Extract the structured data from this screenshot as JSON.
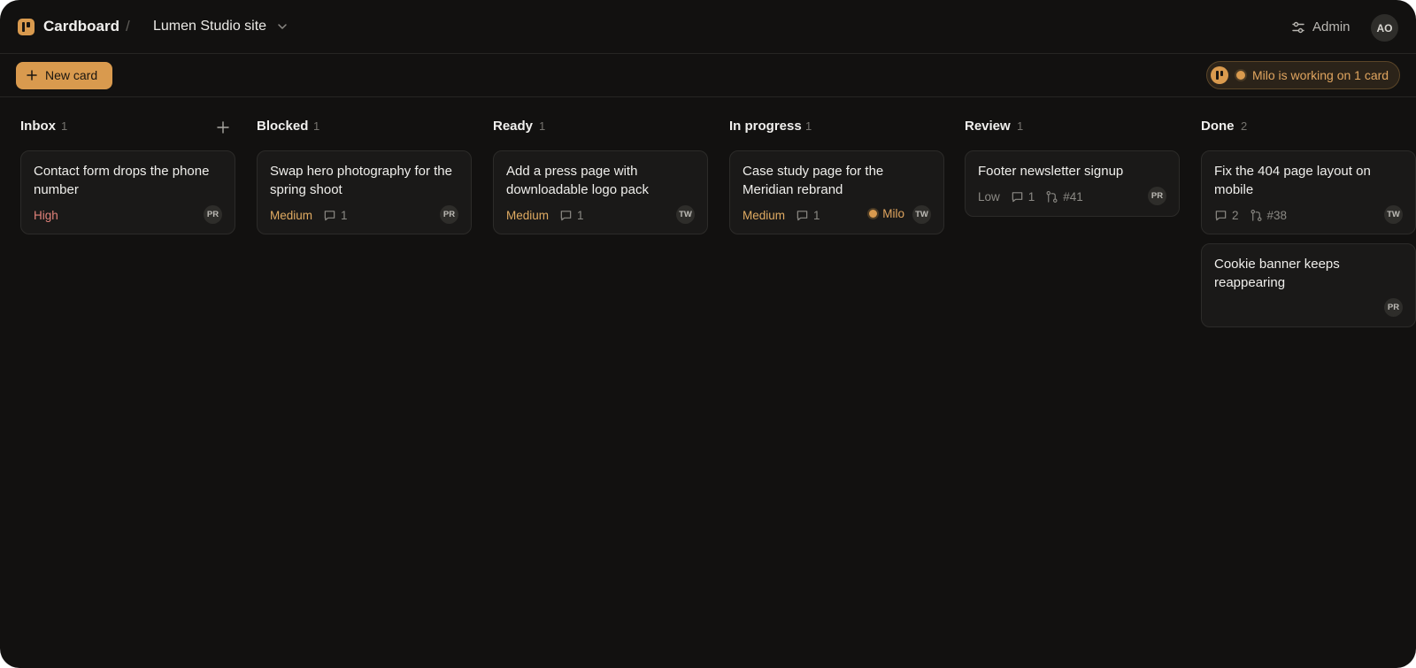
{
  "header": {
    "brand": "Cardboard",
    "separator": "/",
    "project": "Lumen Studio site",
    "admin_label": "Admin",
    "user_initials": "AO"
  },
  "toolbar": {
    "new_card_label": "New card",
    "agent_status": "Milo is working on 1 card"
  },
  "colors": {
    "accent": "#d99a4e",
    "background": "#121110",
    "card": "#1a1918",
    "priority_high": "#e2827a",
    "priority_medium": "#e0ab62",
    "priority_low": "#8b8984"
  },
  "columns": [
    {
      "title": "Inbox",
      "count": "1",
      "cards": [
        {
          "title": "Contact form drops the phone number",
          "priority": "High",
          "assignee": "PR"
        }
      ]
    },
    {
      "title": "Blocked",
      "count": "1",
      "cards": [
        {
          "title": "Swap hero photography for the spring shoot",
          "priority": "Medium",
          "comments": "1",
          "assignee": "PR"
        }
      ]
    },
    {
      "title": "Ready",
      "count": "1",
      "cards": [
        {
          "title": "Add a press page with downloadable logo pack",
          "priority": "Medium",
          "comments": "1",
          "assignee": "TW"
        }
      ]
    },
    {
      "title": "In progress",
      "count": "1",
      "cards": [
        {
          "title": "Case study page for the Meridian rebrand",
          "priority": "Medium",
          "comments": "1",
          "agent": "Milo",
          "assignee": "TW"
        }
      ]
    },
    {
      "title": "Review",
      "count": "1",
      "cards": [
        {
          "title": "Footer newsletter signup",
          "priority": "Low",
          "comments": "1",
          "pr": "#41",
          "assignee": "PR"
        }
      ]
    },
    {
      "title": "Done",
      "count": "2",
      "cards": [
        {
          "title": "Fix the 404 page layout on mobile",
          "comments": "2",
          "pr": "#38",
          "assignee": "TW"
        },
        {
          "title": "Cookie banner keeps reappearing",
          "assignee": "PR"
        }
      ]
    }
  ]
}
